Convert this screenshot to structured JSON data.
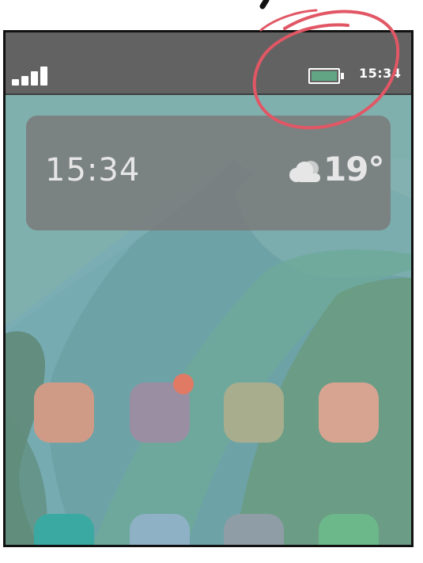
{
  "status_bar": {
    "time": "15:34",
    "signal_icon": "signal-bars-icon",
    "battery_icon": "battery-icon",
    "battery_level": 1.0,
    "battery_color": "#62a585"
  },
  "widget": {
    "time": "15:34",
    "temperature": "19°",
    "weather_icon": "partly-cloudy-icon"
  },
  "apps": [
    {
      "name": "app-1",
      "color": "#cf9b86",
      "row": 1
    },
    {
      "name": "app-2",
      "color": "#9a8ea2",
      "row": 1,
      "has_badge": true
    },
    {
      "name": "app-3",
      "color": "#a8ad8e",
      "row": 1
    },
    {
      "name": "app-4",
      "color": "#d7a492",
      "row": 1
    },
    {
      "name": "app-5",
      "color": "#3aa9a1",
      "row": 2
    },
    {
      "name": "app-6",
      "color": "#8fb1c6",
      "row": 2
    },
    {
      "name": "app-7",
      "color": "#8f9da6",
      "row": 2
    },
    {
      "name": "app-8",
      "color": "#6cb88a",
      "row": 2
    }
  ],
  "colors": {
    "wallpaper_base": "#7fb0ae",
    "status_bar": "#626262",
    "widget": "#7a7a7a",
    "notification_badge": "#e17a64",
    "annotation_circle": "#e15765"
  }
}
